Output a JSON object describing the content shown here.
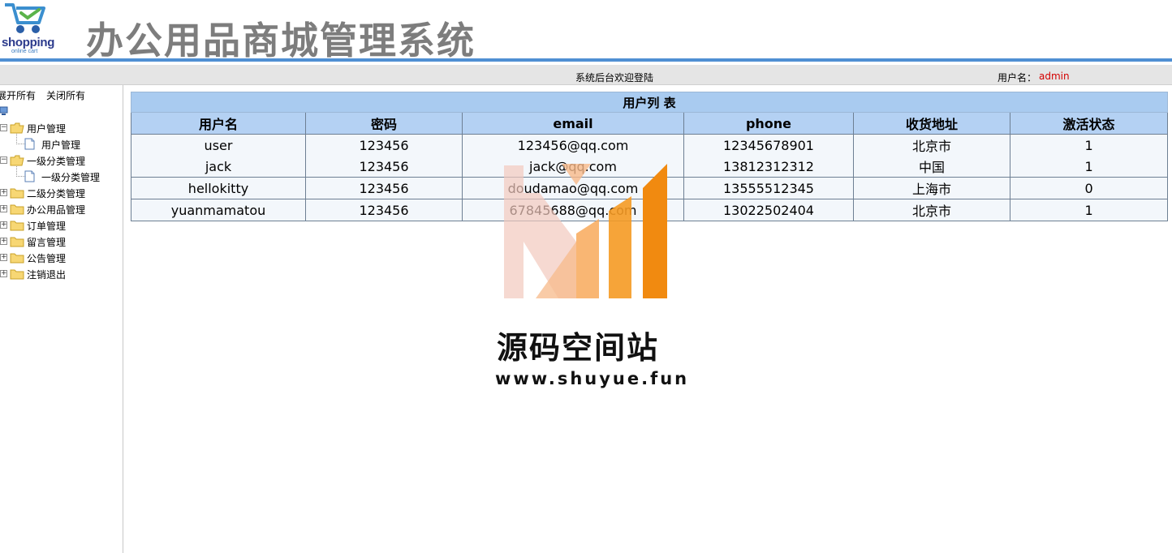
{
  "header": {
    "logo_text": "shopping",
    "logo_subtext": "online cart",
    "title": "办公用品商城管理系统"
  },
  "welcome_bar": {
    "welcome": "系统后台欢迎登陆",
    "user_label": "用户名：",
    "user_name": "admin"
  },
  "sidebar": {
    "expand_all": "展开所有",
    "collapse_all": "关闭所有",
    "items": [
      {
        "label": "用户管理",
        "expanded": true,
        "children": [
          "用户管理"
        ]
      },
      {
        "label": "一级分类管理",
        "expanded": true,
        "children": [
          "一级分类管理"
        ]
      },
      {
        "label": "二级分类管理",
        "expanded": false
      },
      {
        "label": "办公用品管理",
        "expanded": false
      },
      {
        "label": "订单管理",
        "expanded": false
      },
      {
        "label": "留言管理",
        "expanded": false
      },
      {
        "label": "公告管理",
        "expanded": false
      },
      {
        "label": "注销退出",
        "expanded": false
      }
    ]
  },
  "table": {
    "caption": "用户列 表",
    "columns": [
      "用户名",
      "密码",
      "email",
      "phone",
      "收货地址",
      "激活状态"
    ],
    "rows": [
      [
        "user",
        "123456",
        "123456@qq.com",
        "12345678901",
        "北京市",
        "1"
      ],
      [
        "jack",
        "123456",
        "jack@qq.com",
        "13812312312",
        "中国",
        "1"
      ],
      [
        "hellokitty",
        "123456",
        "doudamao@qq.com",
        "13555512345",
        "上海市",
        "0"
      ],
      [
        "yuanmamatou",
        "123456",
        "67845688@qq.com",
        "13022502404",
        "北京市",
        "1"
      ]
    ]
  },
  "watermark": {
    "title": "源码空间站",
    "url": "www.shuyue.fun"
  },
  "colors": {
    "header_line": "#4f8fd3",
    "table_header": "#b4d1f3",
    "user_name": "#d40000",
    "watermark_orange": "#f59a23"
  }
}
